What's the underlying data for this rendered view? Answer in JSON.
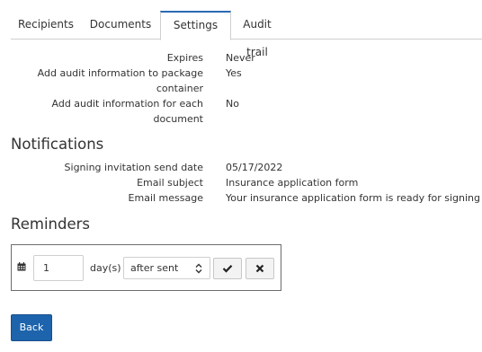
{
  "tabs": [
    {
      "label": "Recipients",
      "active": false
    },
    {
      "label": "Documents",
      "active": false
    },
    {
      "label": "Settings",
      "active": true
    },
    {
      "label": "Audit trail",
      "active": false
    }
  ],
  "settings": {
    "expires_label": "Expires",
    "expires_value": "Never",
    "audit_pkg_label_line1": "Add audit information to package",
    "audit_pkg_label_line2": "container",
    "audit_pkg_value": "Yes",
    "audit_doc_label_line1": "Add audit information for each",
    "audit_doc_label_line2": "document",
    "audit_doc_value": "No"
  },
  "notifications": {
    "heading": "Notifications",
    "send_date_label": "Signing invitation send date",
    "send_date_value": "05/17/2022",
    "subject_label": "Email subject",
    "subject_value": "Insurance application form",
    "message_label": "Email message",
    "message_value": "Your insurance application form is ready for signing"
  },
  "reminders": {
    "heading": "Reminders",
    "days_value": "1",
    "days_label": "day(s)",
    "after_option": "after sent",
    "calendar_icon": "calendar-icon",
    "confirm_icon": "check-icon",
    "cancel_icon": "close-icon"
  },
  "actions": {
    "back_label": "Back"
  },
  "colors": {
    "accent": "#1d64ad",
    "tab_active_border": "#2a6ab4",
    "text": "#333333"
  }
}
